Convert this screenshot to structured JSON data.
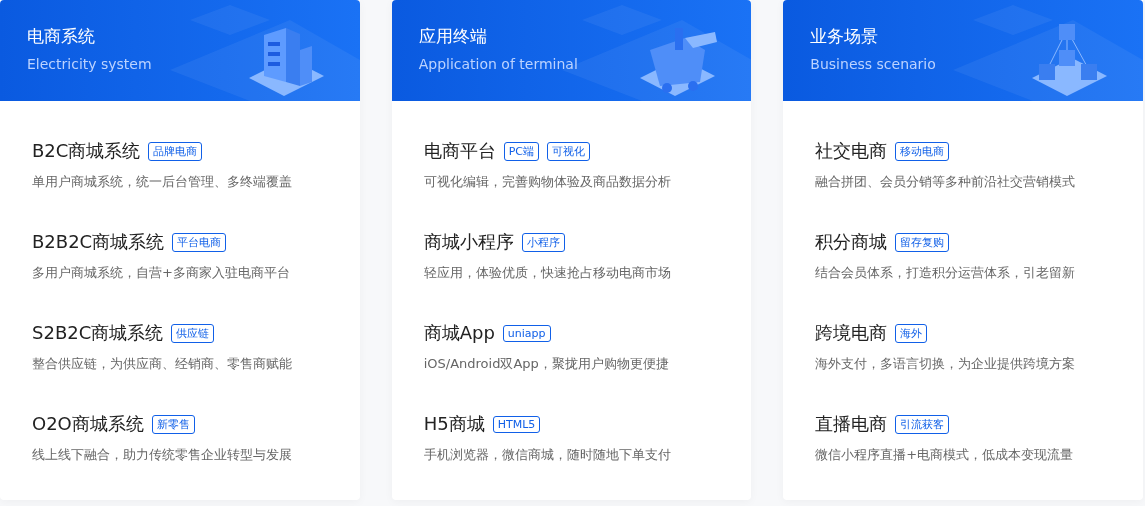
{
  "cards": [
    {
      "title": "电商系统",
      "subtitle": "Electricity system",
      "items": [
        {
          "name": "B2C商城系统",
          "tags": [
            "品牌电商"
          ],
          "desc": "单用户商城系统，统一后台管理、多终端覆盖"
        },
        {
          "name": "B2B2C商城系统",
          "tags": [
            "平台电商"
          ],
          "desc": "多用户商城系统，自营+多商家入驻电商平台"
        },
        {
          "name": "S2B2C商城系统",
          "tags": [
            "供应链"
          ],
          "desc": "整合供应链，为供应商、经销商、零售商赋能"
        },
        {
          "name": "O2O商城系统",
          "tags": [
            "新零售"
          ],
          "desc": "线上线下融合，助力传统零售企业转型与发展"
        }
      ]
    },
    {
      "title": "应用终端",
      "subtitle": "Application of terminal",
      "items": [
        {
          "name": "电商平台",
          "tags": [
            "PC端",
            "可视化"
          ],
          "desc": "可视化编辑，完善购物体验及商品数据分析"
        },
        {
          "name": "商城小程序",
          "tags": [
            "小程序"
          ],
          "desc": "轻应用，体验优质，快速抢占移动电商市场"
        },
        {
          "name": "商城App",
          "tags": [
            "uniapp"
          ],
          "desc": "iOS/Android双App，聚拢用户购物更便捷"
        },
        {
          "name": "H5商城",
          "tags": [
            "HTML5"
          ],
          "desc": "手机浏览器，微信商城，随时随地下单支付"
        }
      ]
    },
    {
      "title": "业务场景",
      "subtitle": "Business scenario",
      "items": [
        {
          "name": "社交电商",
          "tags": [
            "移动电商"
          ],
          "desc": "融合拼团、会员分销等多种前沿社交营销模式"
        },
        {
          "name": "积分商城",
          "tags": [
            "留存复购"
          ],
          "desc": "结合会员体系，打造积分运营体系，引老留新"
        },
        {
          "name": "跨境电商",
          "tags": [
            "海外"
          ],
          "desc": "海外支付，多语言切换，为企业提供跨境方案"
        },
        {
          "name": "直播电商",
          "tags": [
            "引流获客"
          ],
          "desc": "微信小程序直播+电商模式，低成本变现流量"
        }
      ]
    }
  ]
}
